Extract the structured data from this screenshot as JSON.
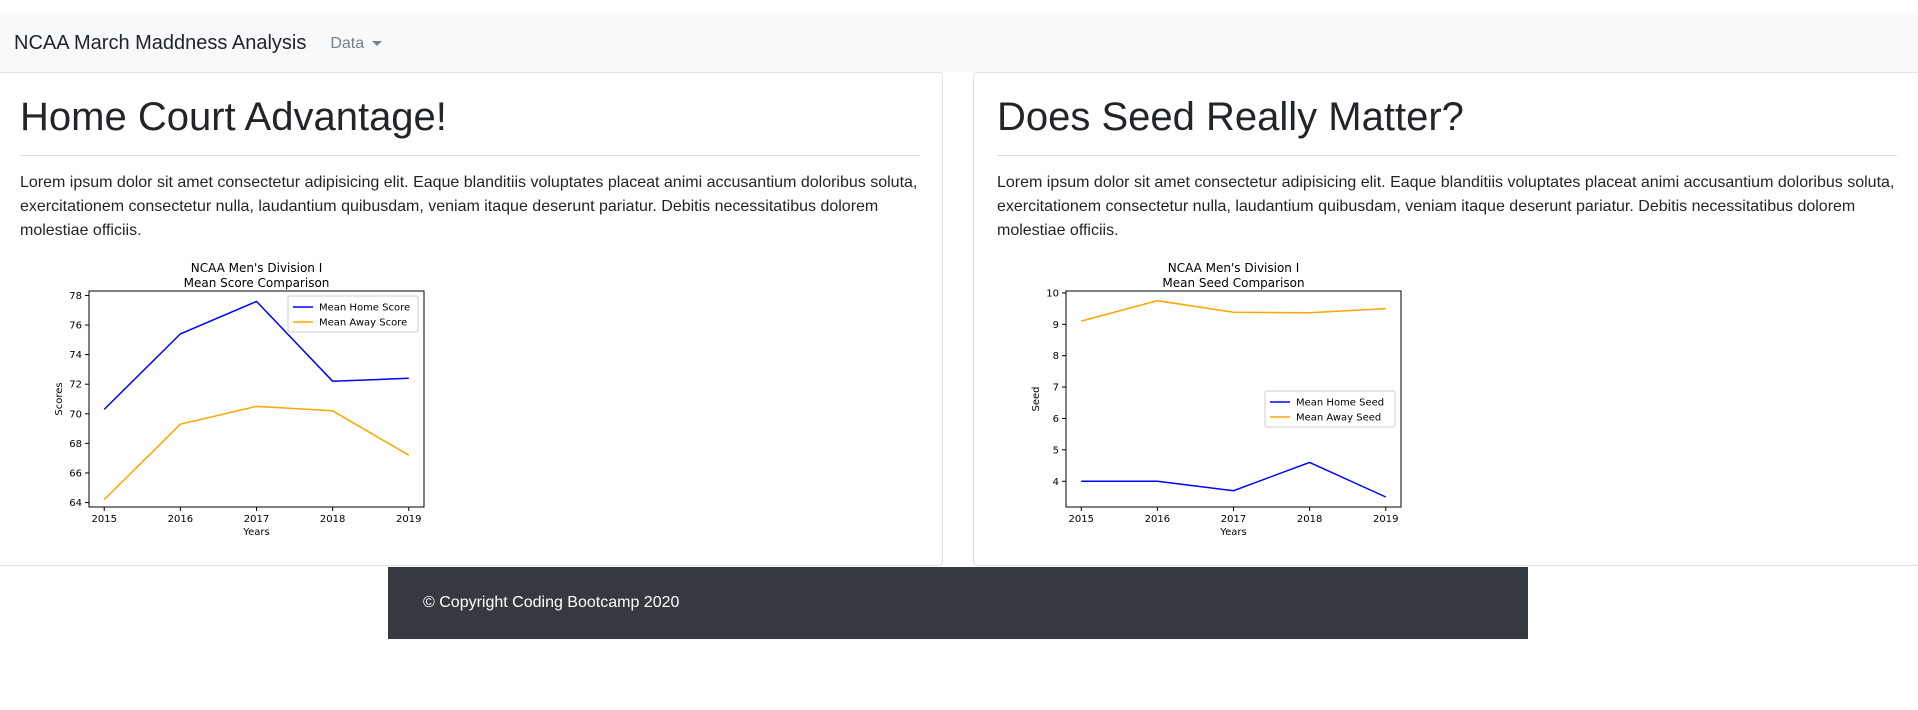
{
  "navbar": {
    "brand": "NCAA March Maddness Analysis",
    "dropdown_label": "Data"
  },
  "cards": [
    {
      "title": "Home Court Advantage!",
      "text": "Lorem ipsum dolor sit amet consectetur adipisicing elit. Eaque blanditiis voluptates placeat animi accusantium doloribus soluta, exercitationem consectetur nulla, laudantium quibusdam, veniam itaque deserunt pariatur. Debitis necessitatibus dolorem molestiae officiis."
    },
    {
      "title": "Does Seed Really Matter?",
      "text": "Lorem ipsum dolor sit amet consectetur adipisicing elit. Eaque blanditiis voluptates placeat animi accusantium doloribus soluta, exercitationem consectetur nulla, laudantium quibusdam, veniam itaque deserunt pariatur. Debitis necessitatibus dolorem molestiae officiis."
    }
  ],
  "chart_data": [
    {
      "type": "line",
      "title": "NCAA Men's Division I",
      "subtitle": "Mean Score Comparison",
      "xlabel": "Years",
      "ylabel": "Scores",
      "x": [
        2015,
        2016,
        2017,
        2018,
        2019
      ],
      "xlim": [
        2014.8,
        2019.2
      ],
      "ylim": [
        63.7,
        78.3
      ],
      "yticks": [
        64,
        66,
        68,
        70,
        72,
        74,
        76,
        78
      ],
      "grid": false,
      "legend_position": "top-right",
      "series": [
        {
          "name": "Mean Home Score",
          "color": "#0000ff",
          "values": [
            70.3,
            75.4,
            77.6,
            72.2,
            72.4
          ]
        },
        {
          "name": "Mean Away Score",
          "color": "#ffa500",
          "values": [
            64.2,
            69.3,
            70.5,
            70.2,
            67.2
          ]
        }
      ]
    },
    {
      "type": "line",
      "title": "NCAA Men's Division I",
      "subtitle": "Mean Seed Comparison",
      "xlabel": "Years",
      "ylabel": "Seed",
      "x": [
        2015,
        2016,
        2017,
        2018,
        2019
      ],
      "xlim": [
        2014.8,
        2019.2
      ],
      "ylim": [
        3.18,
        10.06
      ],
      "yticks": [
        4,
        5,
        6,
        7,
        8,
        9,
        10
      ],
      "grid": false,
      "legend_position": "center-right",
      "series": [
        {
          "name": "Mean Home Seed",
          "color": "#0000ff",
          "values": [
            4.0,
            4.0,
            3.7,
            4.6,
            3.5
          ]
        },
        {
          "name": "Mean Away Seed",
          "color": "#ffa500",
          "values": [
            9.1,
            9.75,
            9.38,
            9.37,
            9.5
          ]
        }
      ]
    }
  ],
  "footer": {
    "copyright": "© Copyright Coding Bootcamp 2020"
  }
}
